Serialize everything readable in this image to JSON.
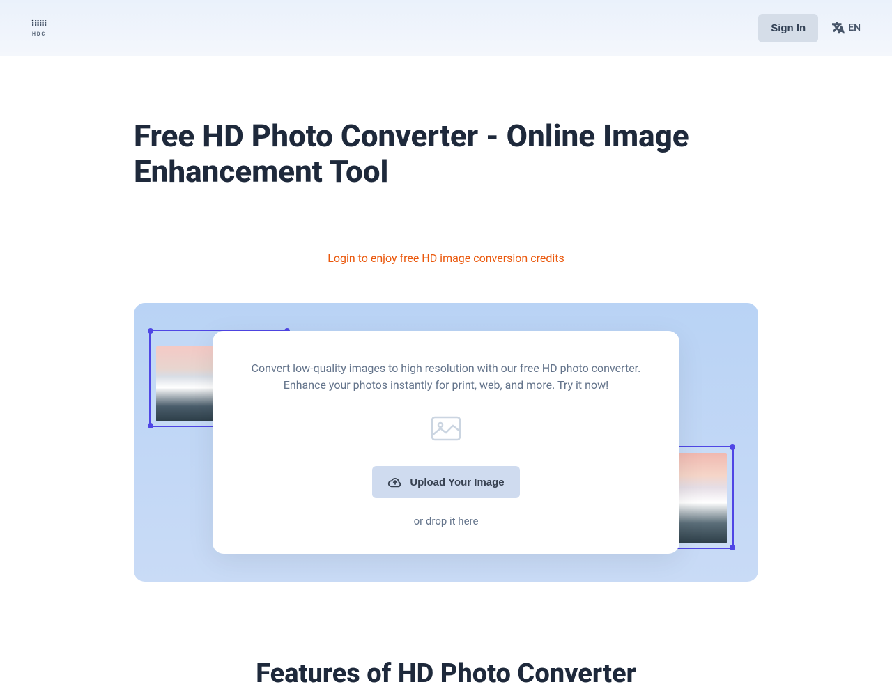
{
  "header": {
    "logo_text": "HDC",
    "signin_label": "Sign In",
    "lang_code": "EN"
  },
  "main": {
    "title": "Free HD Photo Converter - Online Image Enhancement Tool",
    "login_notice": "Login to enjoy free HD image conversion credits",
    "upload": {
      "description": "Convert low-quality images to high resolution with our free HD photo converter. Enhance your photos instantly for print, web, and more. Try it now!",
      "button_label": "Upload Your Image",
      "drop_hint": "or drop it here"
    },
    "features_title": "Features of HD Photo Converter"
  }
}
